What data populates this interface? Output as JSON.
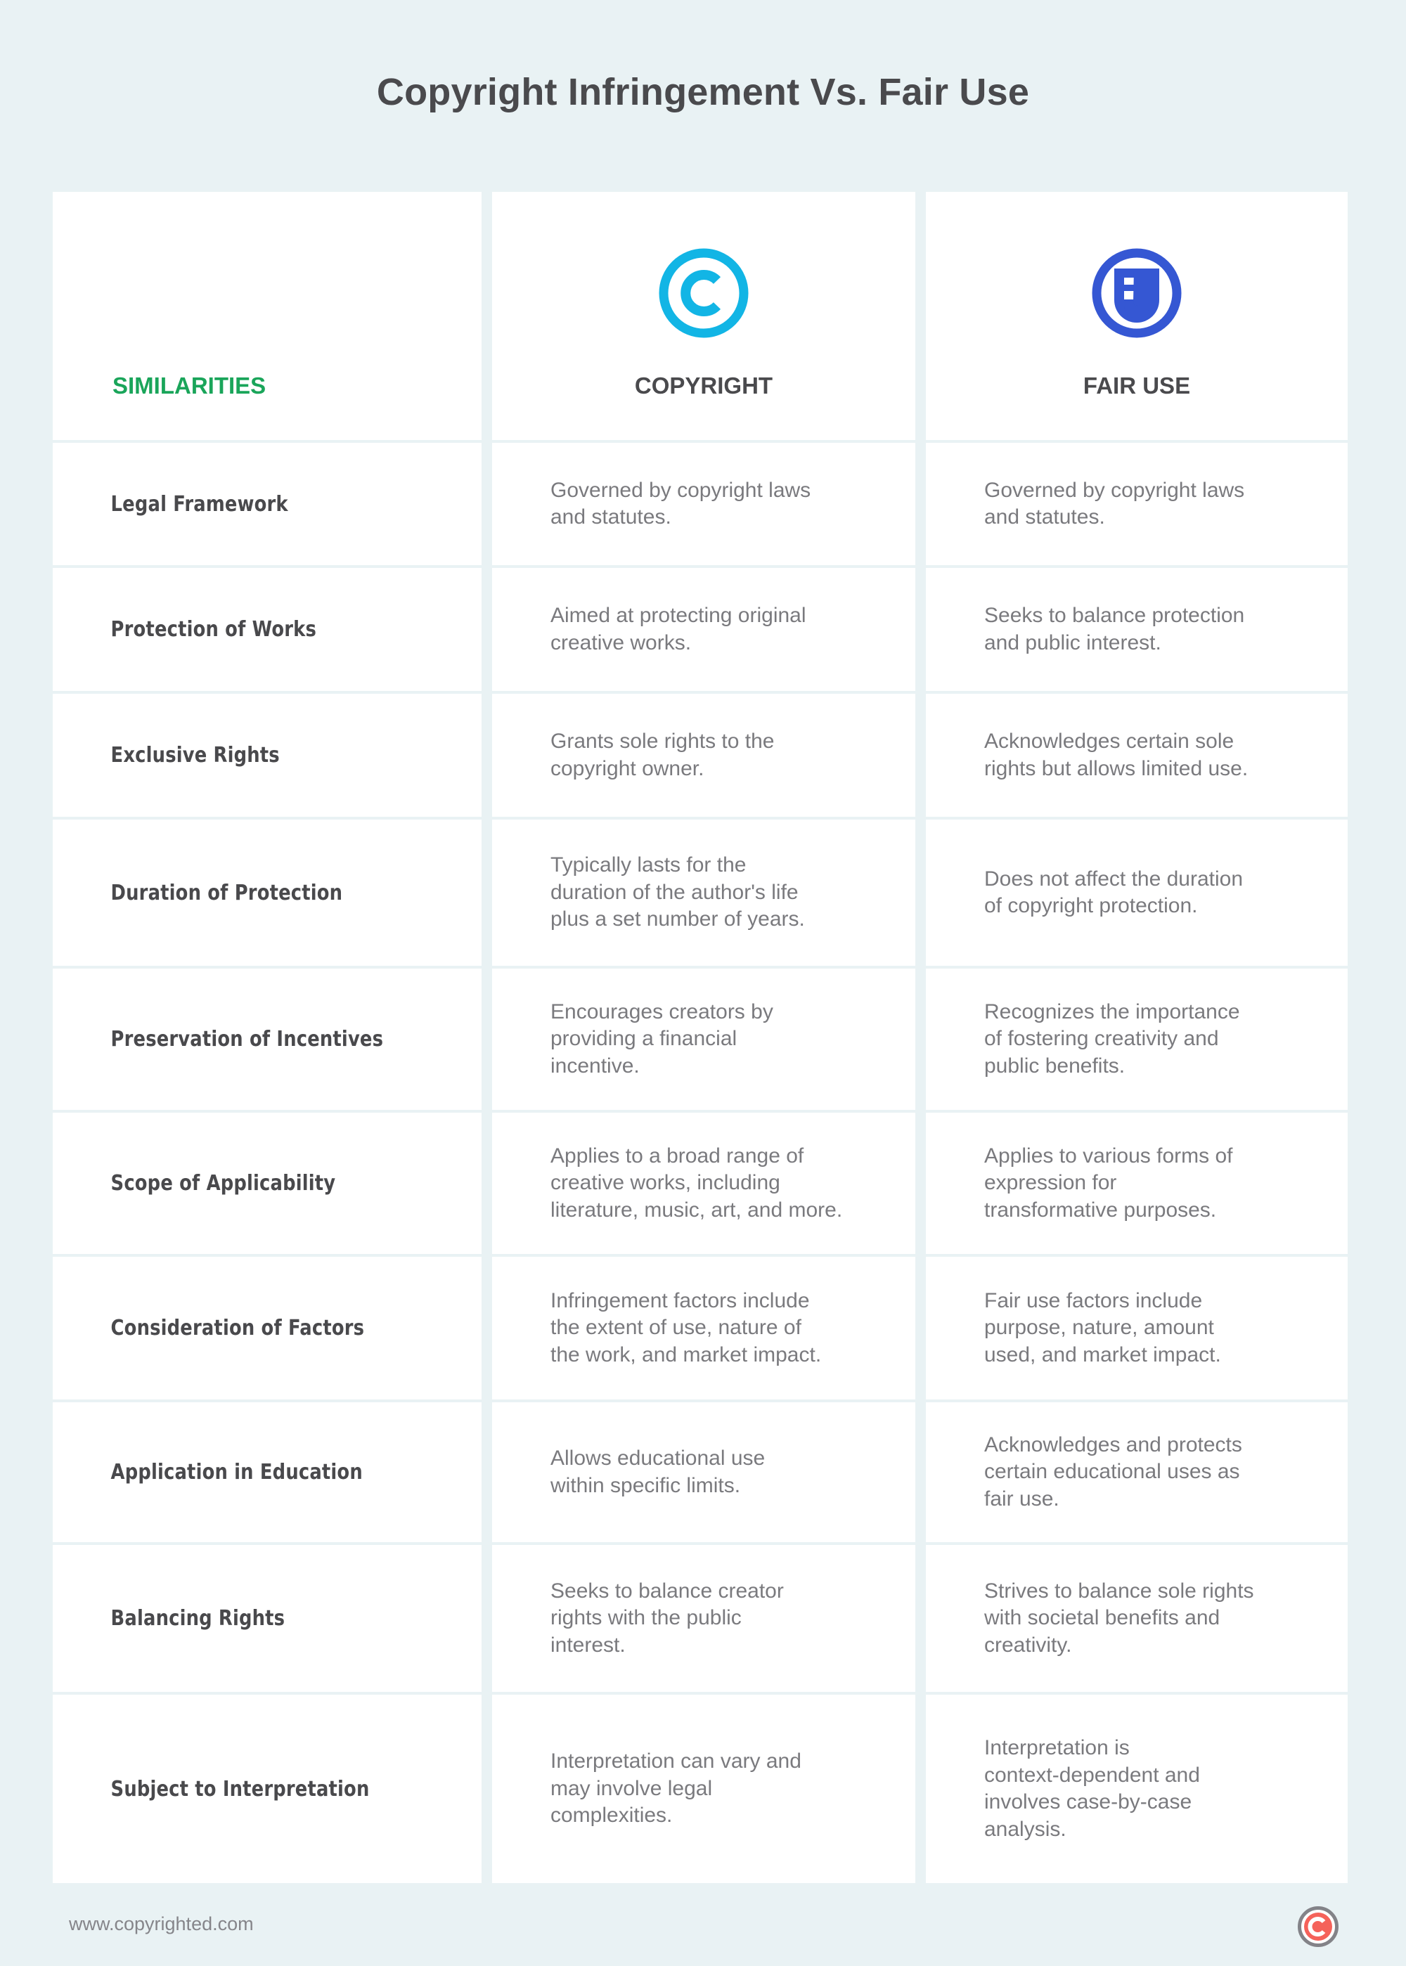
{
  "title": "Copyright Infringement Vs. Fair Use",
  "header": {
    "similarities_label": "SIMILARITIES",
    "columns": [
      {
        "label": "COPYRIGHT",
        "icon": "copyright-icon",
        "color": "#12b5e5"
      },
      {
        "label": "FAIR USE",
        "icon": "fair-use-icon",
        "color": "#3557d3"
      }
    ]
  },
  "colors": {
    "background": "#e9f2f4",
    "accent_green": "#1aa55a",
    "copyright_blue": "#12b5e5",
    "fair_use_blue": "#3557d3",
    "footer_logo_red": "#f5625a"
  },
  "rows": [
    {
      "label": "Legal Framework",
      "copyright": [
        "Governed by copyright laws",
        "and statutes."
      ],
      "fair_use": [
        "Governed by copyright laws",
        "and statutes."
      ]
    },
    {
      "label": "Protection of Works",
      "copyright": [
        "Aimed at protecting original",
        "creative works."
      ],
      "fair_use": [
        "Seeks to balance protection",
        "and public interest."
      ]
    },
    {
      "label": "Exclusive Rights",
      "copyright": [
        "Grants sole rights to the",
        "copyright owner."
      ],
      "fair_use": [
        "Acknowledges certain sole",
        "rights but allows limited use."
      ]
    },
    {
      "label": "Duration of Protection",
      "copyright": [
        "Typically lasts for the",
        "duration of the author's life",
        "plus a set number of years."
      ],
      "fair_use": [
        "Does not affect the duration",
        "of copyright protection."
      ]
    },
    {
      "label": "Preservation of Incentives",
      "copyright": [
        "Encourages creators by",
        "providing a financial",
        "incentive."
      ],
      "fair_use": [
        "Recognizes the importance",
        "of fostering creativity and",
        "public benefits."
      ]
    },
    {
      "label": "Scope of Applicability",
      "copyright": [
        "Applies to a broad range of",
        "creative works, including",
        "literature, music, art, and more."
      ],
      "fair_use": [
        "Applies to various forms of",
        "expression for",
        "transformative purposes."
      ]
    },
    {
      "label": "Consideration of Factors",
      "copyright": [
        "Infringement factors include",
        "the extent of use, nature of",
        "the work, and market impact."
      ],
      "fair_use": [
        "Fair use factors include",
        "purpose, nature, amount",
        "used, and market impact."
      ]
    },
    {
      "label": "Application in Education",
      "copyright": [
        "Allows educational use",
        "within specific limits."
      ],
      "fair_use": [
        "Acknowledges and protects",
        "certain educational uses as",
        "fair use."
      ]
    },
    {
      "label": "Balancing Rights",
      "copyright": [
        "Seeks to balance creator",
        "rights with the public",
        "interest."
      ],
      "fair_use": [
        "Strives to balance sole rights",
        "with societal benefits and",
        "creativity."
      ]
    },
    {
      "label": "Subject to Interpretation",
      "copyright": [
        "Interpretation can vary and",
        "may involve legal",
        "complexities."
      ],
      "fair_use": [
        "Interpretation is",
        "context-dependent and",
        "involves case-by-case",
        "analysis."
      ]
    }
  ],
  "footer": {
    "url": "www.copyrighted.com",
    "logo_icon": "copyright-logo-icon"
  }
}
